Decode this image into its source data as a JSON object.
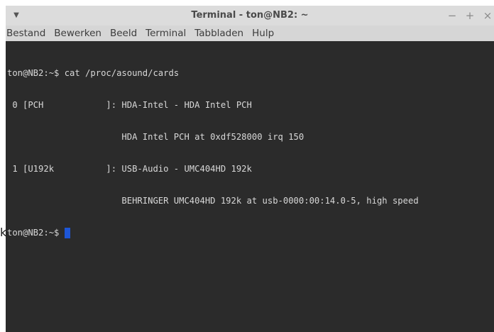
{
  "backdrop": {
    "edge_glyph": "k"
  },
  "window": {
    "title": "Terminal - ton@NB2: ~",
    "menu_icon": "triangle-down",
    "controls": {
      "minimize": "−",
      "maximize": "+",
      "close": "×"
    }
  },
  "menubar": {
    "items": [
      "Bestand",
      "Bewerken",
      "Beeld",
      "Terminal",
      "Tabbladen",
      "Hulp"
    ]
  },
  "terminal": {
    "lines": [
      "ton@NB2:~$ cat /proc/asound/cards",
      " 0 [PCH            ]: HDA-Intel - HDA Intel PCH",
      "                      HDA Intel PCH at 0xdf528000 irq 150",
      " 1 [U192k          ]: USB-Audio - UMC404HD 192k",
      "                      BEHRINGER UMC404HD 192k at usb-0000:00:14.0-5, high speed"
    ],
    "prompt": "ton@NB2:~$ ",
    "colors": {
      "background": "#2b2b2b",
      "foreground": "#d8d8d8",
      "cursor": "#1e56d6"
    }
  }
}
